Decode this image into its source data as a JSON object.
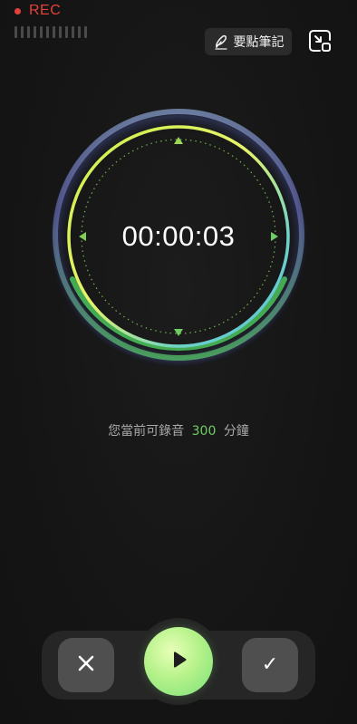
{
  "status": {
    "rec_label": "REC",
    "rec_color": "#e5413a"
  },
  "header": {
    "notes_label": "要點筆記",
    "notes_icon": "pen-icon",
    "minimize_icon": "minimize-icon"
  },
  "recorder": {
    "elapsed": "00:00:03",
    "remaining_prefix": "您當前可錄音",
    "remaining_minutes": "300",
    "remaining_suffix": "分鐘",
    "accent_color": "#6fce63"
  },
  "controls": {
    "cancel_icon": "close-icon",
    "play_icon": "play-icon",
    "confirm_icon": "check-icon",
    "confirm_glyph": "✓"
  }
}
